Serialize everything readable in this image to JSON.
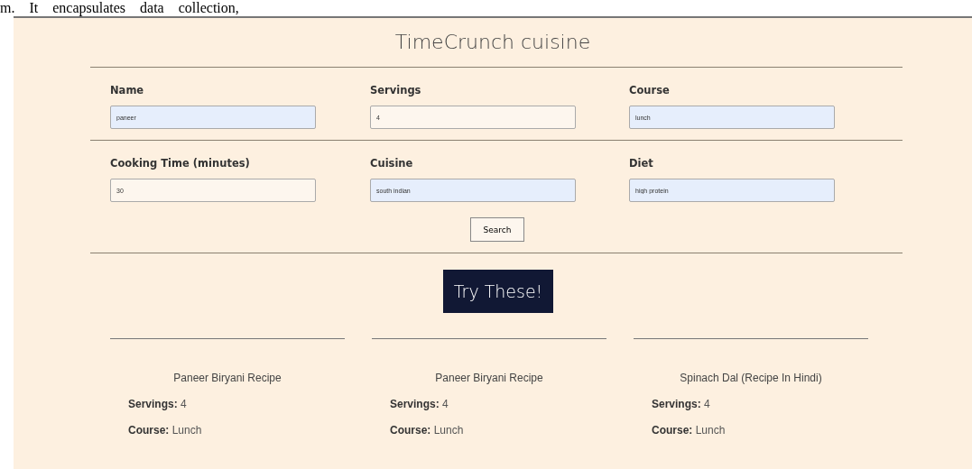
{
  "document_text": "m.    It    encapsulates    data    collection,",
  "title": "TimeCrunch cuisine",
  "form_rows": [
    [
      {
        "label": "Name",
        "value": "paneer",
        "autofilled": true
      },
      {
        "label": "Servings",
        "value": "4",
        "autofilled": false
      },
      {
        "label": "Course",
        "value": "lunch",
        "autofilled": true
      }
    ],
    [
      {
        "label": "Cooking Time (minutes)",
        "value": "30",
        "autofilled": false
      },
      {
        "label": "Cuisine",
        "value": "south indian",
        "autofilled": true
      },
      {
        "label": "Diet",
        "value": "high protein",
        "autofilled": true
      }
    ]
  ],
  "search_button": "Search",
  "banner": "Try These!",
  "recipes": [
    {
      "title": "Paneer Biryani Recipe",
      "fields": [
        {
          "label": "Servings:",
          "value": "4"
        },
        {
          "label": "Course:",
          "value": "Lunch"
        }
      ]
    },
    {
      "title": "Paneer Biryani Recipe",
      "fields": [
        {
          "label": "Servings:",
          "value": "4"
        },
        {
          "label": "Course:",
          "value": "Lunch"
        }
      ]
    },
    {
      "title": "Spinach Dal (Recipe In Hindi)",
      "fields": [
        {
          "label": "Servings:",
          "value": "4"
        },
        {
          "label": "Course:",
          "value": "Lunch"
        }
      ]
    }
  ]
}
